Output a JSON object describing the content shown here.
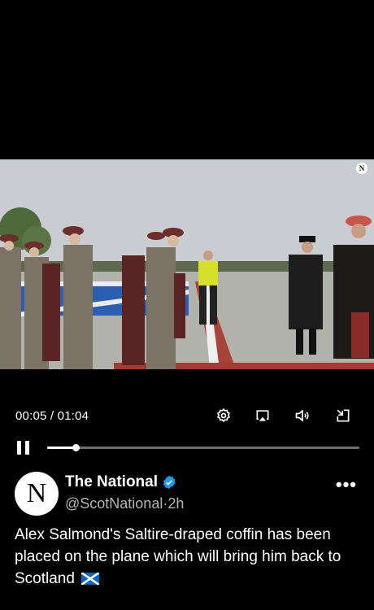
{
  "video": {
    "current_time": "00:05",
    "separator": " / ",
    "duration": "01:04",
    "progress_fraction": 0.092,
    "watermark": "N"
  },
  "controls": {
    "settings_icon": "gear-icon",
    "airplay_icon": "airplay-icon",
    "volume_icon": "speaker-icon",
    "exit_fullscreen_icon": "minimize-icon",
    "pause_icon": "pause-icon"
  },
  "post": {
    "avatar_letter": "N",
    "display_name": "The National",
    "handle": "@ScotNational",
    "dot": "·",
    "age": "2h",
    "more": "•••",
    "text": "Alex Salmond's Saltire-draped coffin has been placed on the plane which will bring him back to Scotland",
    "emoji": "scotland-flag-icon"
  },
  "colors": {
    "background": "#000000",
    "verified_blue": "#1d9bf0",
    "handle_grey": "#b5b5b5",
    "saltire_blue": "#0065bd"
  }
}
